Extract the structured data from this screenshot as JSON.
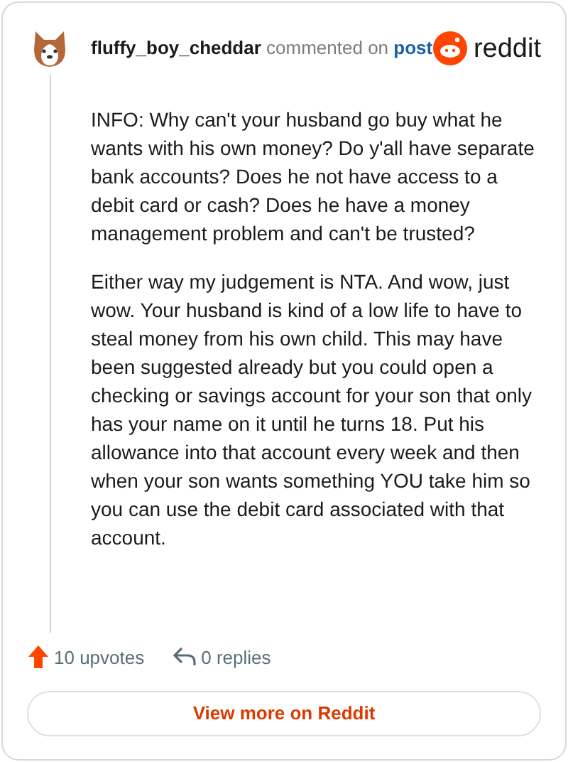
{
  "comment": {
    "author": "fluffy_boy_cheddar",
    "action": "commented on",
    "target": "post",
    "brand": "reddit",
    "paragraphs": [
      "INFO: Why can't your husband go buy what he wants with his own money? Do y'all have separate bank accounts? Does he not have access to a debit card or cash? Does he have a money management problem and can't be trusted?",
      "Either way my judgement is NTA. And wow, just wow. Your husband is kind of a low life to have to steal money from his own child. This may have been suggested already but you could open a checking or savings account for your son that only has your name on it until he turns 18. Put his allowance into that account every week and then when your son wants something YOU take him so you can use the debit card associated with that account."
    ],
    "upvotes": "10 upvotes",
    "replies": "0 replies",
    "button": "View more on Reddit"
  }
}
